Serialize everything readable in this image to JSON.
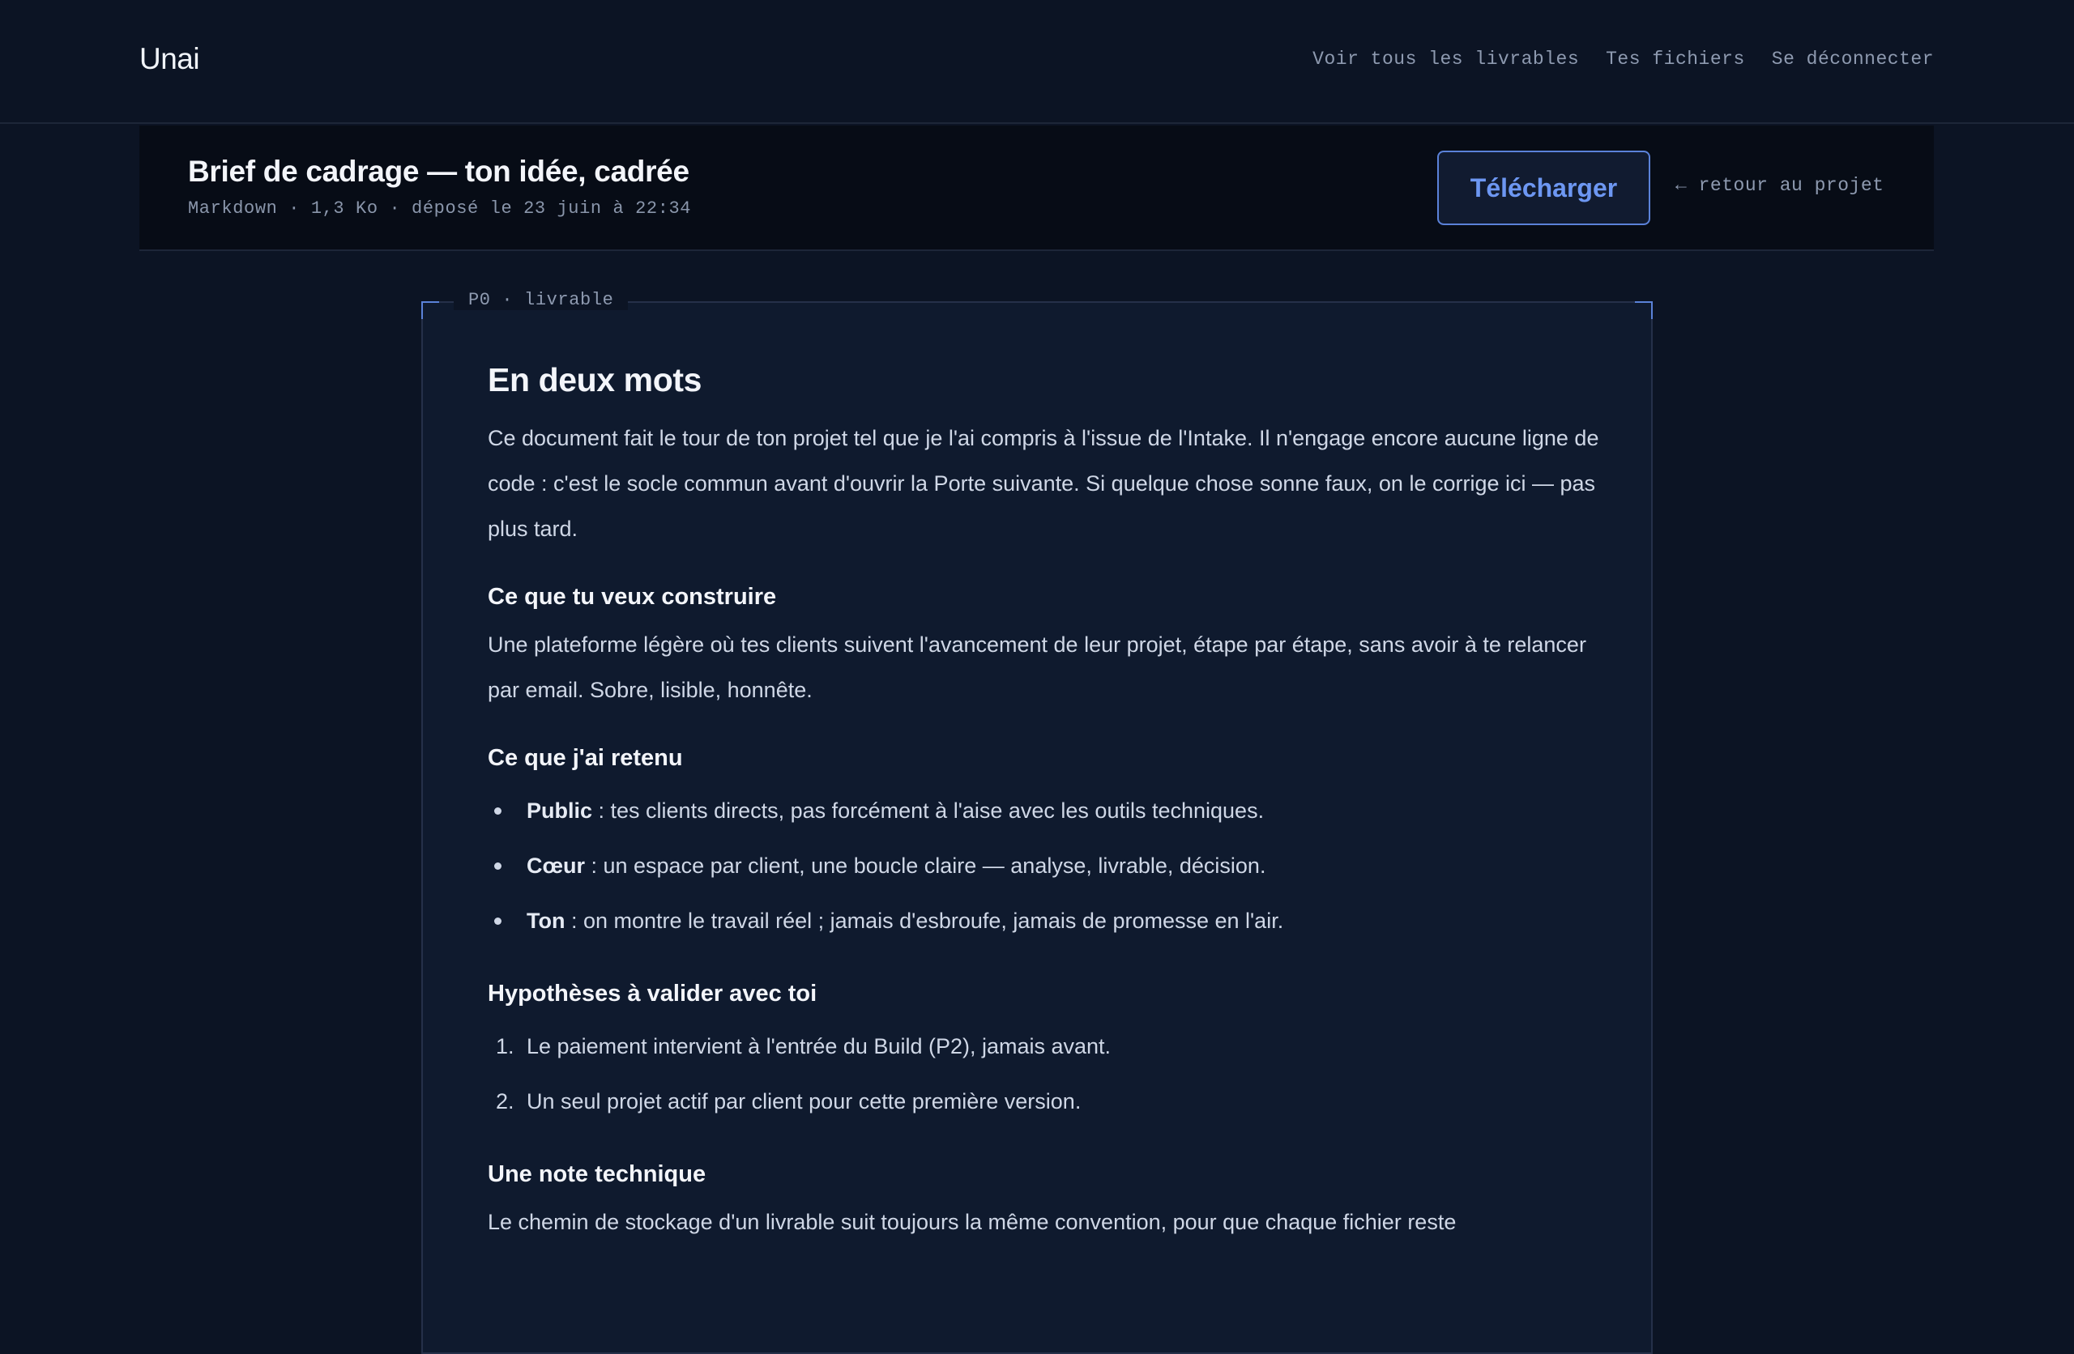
{
  "header": {
    "brand": "Unai",
    "nav": [
      {
        "label": "Voir tous les livrables"
      },
      {
        "label": "Tes fichiers"
      },
      {
        "label": "Se déconnecter"
      }
    ]
  },
  "file": {
    "title": "Brief de cadrage — ton idée, cadrée",
    "meta": "Markdown · 1,3 Ko · déposé le 23 juin à 22:34",
    "download_label": "Télécharger",
    "back_label": "← retour au projet"
  },
  "doc": {
    "tag": "P0 · livrable",
    "title": "En deux mots",
    "intro": "Ce document fait le tour de ton projet tel que je l'ai compris à l'issue de l'Intake. Il n'engage encore aucune ligne de code : c'est le socle commun avant d'ouvrir la Porte suivante. Si quelque chose sonne faux, on le corrige ici — pas plus tard.",
    "sections": {
      "build": {
        "heading": "Ce que tu veux construire",
        "text": "Une plateforme légère où tes clients suivent l'avancement de leur projet, étape par étape, sans avoir à te relancer par email. Sobre, lisible, honnête."
      },
      "retained": {
        "heading": "Ce que j'ai retenu",
        "items": [
          {
            "term": "Public",
            "text": " : tes clients directs, pas forcément à l'aise avec les outils techniques."
          },
          {
            "term": "Cœur",
            "text": " : un espace par client, une boucle claire — analyse, livrable, décision."
          },
          {
            "term": "Ton",
            "text": " : on montre le travail réel ; jamais d'esbroufe, jamais de promesse en l'air."
          }
        ]
      },
      "hypotheses": {
        "heading": "Hypothèses à valider avec toi",
        "items": [
          {
            "num": "1.",
            "text": "Le paiement intervient à l'entrée du Build (P2), jamais avant."
          },
          {
            "num": "2.",
            "text": "Un seul projet actif par client pour cette première version."
          }
        ]
      },
      "tech": {
        "heading": "Une note technique",
        "text": "Le chemin de stockage d'un livrable suit toujours la même convention, pour que chaque fichier reste"
      }
    }
  }
}
